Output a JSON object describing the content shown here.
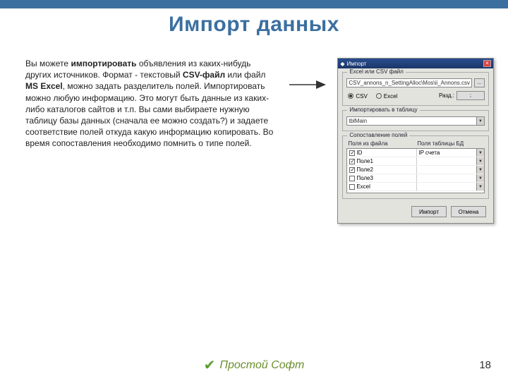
{
  "slide": {
    "title": "Импорт данных",
    "page_number": "18"
  },
  "text": {
    "part1": "Вы можете ",
    "bold1": "импортировать",
    "part2": " объявления из каких-нибудь других источников. Формат - текстовый ",
    "bold2": "CSV-файл",
    "part3": " или файл ",
    "bold3": "MS Excel",
    "part4": ", можно задать разделитель полей. Импортировать можно любую информацию. Это могут быть данные из каких-либо каталогов сайтов и т.п. Вы сами выбираете нужную таблицу базы данных (сначала ее можно создать?) и задаете соответствие полей откуда какую информацию копировать. Во время сопоставления необходимо помнить о типе полей."
  },
  "dialog": {
    "title": "Импорт",
    "close": "×",
    "group1_label": "Excel или CSV файл",
    "file_value": "CSV_annons_n_SettingAlloc\\Mos\\ii_Annons.csv",
    "browse": "...",
    "delim_label": "Разд.:",
    "group2_label": "Импортировать в таблицу",
    "table_value": "tblMain",
    "group3_label": "Сопоставление полей",
    "header_src": "Поля из файла",
    "header_dst": "Поля таблицы БД",
    "rows": [
      {
        "checked": true,
        "src": "ID",
        "dst": "IP счета"
      },
      {
        "checked": true,
        "src": "Поле1",
        "dst": ""
      },
      {
        "checked": true,
        "src": "Поле2",
        "dst": ""
      },
      {
        "checked": false,
        "src": "Поле3",
        "dst": ""
      },
      {
        "checked": false,
        "src": "Excel",
        "dst": ""
      }
    ],
    "btn_import": "Импорт",
    "btn_cancel": "Отмена"
  },
  "footer": {
    "brand": "Простой Софт"
  }
}
